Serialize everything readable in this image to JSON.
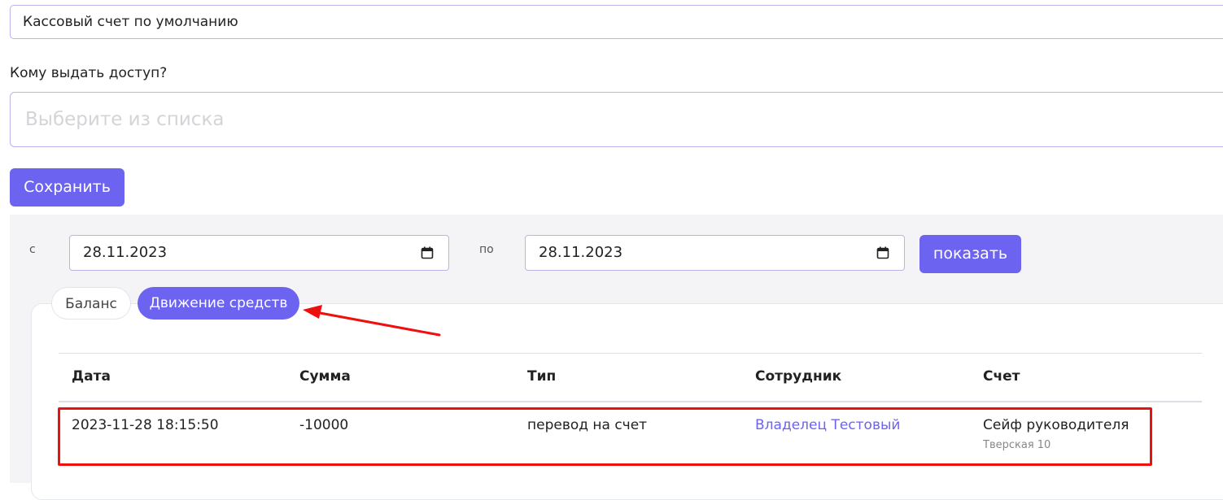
{
  "form": {
    "default_account": "Кассовый счет по умолчанию",
    "access_label": "Кому выдать доступ?",
    "access_placeholder": "Выберите из списка",
    "save_label": "Сохранить"
  },
  "filter": {
    "from_label": "с",
    "from_date": "28.11.2023",
    "to_label": "по",
    "to_date": "28.11.2023",
    "show_label": "показать"
  },
  "tabs": [
    {
      "label": "Баланс",
      "active": false
    },
    {
      "label": "Движение средств",
      "active": true
    }
  ],
  "table": {
    "headers": [
      "Дата",
      "Сумма",
      "Тип",
      "Сотрудник",
      "Счет"
    ],
    "rows": [
      {
        "date": "2023-11-28 18:15:50",
        "amount": "-10000",
        "type": "перевод на счет",
        "employee": "Владелец Тестовый",
        "account": "Сейф руководителя",
        "account_sub": "Тверская 10"
      }
    ]
  },
  "colors": {
    "accent": "#6c63f0",
    "annotation": "#ee0f0f",
    "border": "#b9b4ea"
  },
  "icons": [
    "calendar-icon"
  ]
}
